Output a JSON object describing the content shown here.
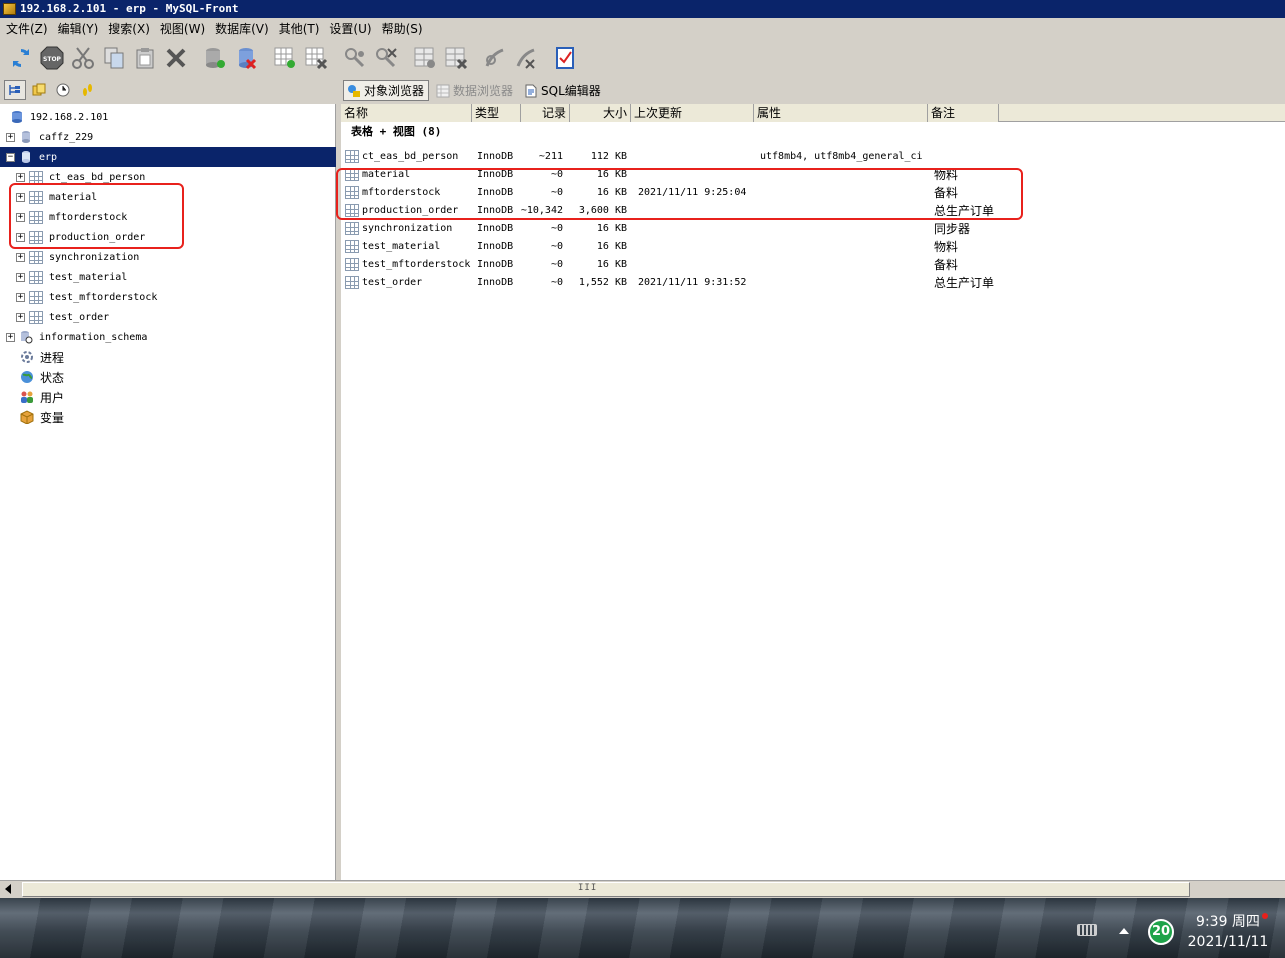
{
  "window": {
    "title": "192.168.2.101 - erp - MySQL-Front"
  },
  "menu": [
    "文件(Z)",
    "编辑(Y)",
    "搜索(X)",
    "视图(W)",
    "数据库(V)",
    "其他(T)",
    "设置(U)",
    "帮助(S)"
  ],
  "toolbar": {
    "icons": [
      "refresh-icon",
      "stop-icon",
      "cut-icon",
      "copy-icon",
      "paste-icon",
      "delete-icon",
      "new-database-icon",
      "drop-database-icon",
      "new-table-icon",
      "drop-table-icon",
      "new-field-icon",
      "drop-field-icon",
      "new-index-icon",
      "drop-index-icon",
      "new-foreign-key-icon",
      "drop-foreign-key-icon",
      "properties-icon"
    ],
    "stop_label": "STOP"
  },
  "views": {
    "object_browser": "对象浏览器",
    "data_browser": "数据浏览器",
    "sql_editor": "SQL编辑器"
  },
  "tree": {
    "server": "192.168.2.101",
    "databases": [
      {
        "name": "caffz_229",
        "expanded": false
      },
      {
        "name": "erp",
        "expanded": true,
        "selected": true,
        "tables": [
          "ct_eas_bd_person",
          "material",
          "mftorderstock",
          "production_order",
          "synchronization",
          "test_material",
          "test_mftorderstock",
          "test_order"
        ]
      },
      {
        "name": "information_schema",
        "expanded": false
      }
    ],
    "extras": [
      "进程",
      "状态",
      "用户",
      "变量"
    ]
  },
  "grid": {
    "columns": [
      "名称",
      "类型",
      "记录",
      "大小",
      "上次更新",
      "属性",
      "备注"
    ],
    "group_title": "表格 + 视图 (8)",
    "rows": [
      {
        "name": "ct_eas_bd_person",
        "type": "InnoDB",
        "records": "~211",
        "size": "112 KB",
        "updated": "",
        "attributes": "utf8mb4, utf8mb4_general_ci",
        "comment": ""
      },
      {
        "name": "material",
        "type": "InnoDB",
        "records": "~0",
        "size": "16 KB",
        "updated": "",
        "attributes": "",
        "comment": "物料"
      },
      {
        "name": "mftorderstock",
        "type": "InnoDB",
        "records": "~0",
        "size": "16 KB",
        "updated": "2021/11/11 9:25:04",
        "attributes": "",
        "comment": "备料"
      },
      {
        "name": "production_order",
        "type": "InnoDB",
        "records": "~10,342",
        "size": "3,600 KB",
        "updated": "",
        "attributes": "",
        "comment": "总生产订单"
      },
      {
        "name": "synchronization",
        "type": "InnoDB",
        "records": "~0",
        "size": "16 KB",
        "updated": "",
        "attributes": "",
        "comment": "同步器"
      },
      {
        "name": "test_material",
        "type": "InnoDB",
        "records": "~0",
        "size": "16 KB",
        "updated": "",
        "attributes": "",
        "comment": "物料"
      },
      {
        "name": "test_mftorderstock",
        "type": "InnoDB",
        "records": "~0",
        "size": "16 KB",
        "updated": "",
        "attributes": "",
        "comment": "备料"
      },
      {
        "name": "test_order",
        "type": "InnoDB",
        "records": "~0",
        "size": "1,552 KB",
        "updated": "2021/11/11 9:31:52",
        "attributes": "",
        "comment": "总生产订单"
      }
    ]
  },
  "scrollbar": {
    "grip": "III"
  },
  "taskbar": {
    "badge": "20",
    "time": "9:39 周四",
    "date": "2021/11/11"
  },
  "colors": {
    "highlight": "#e8211c",
    "selection": "#0a246a",
    "chrome": "#d4d0c8"
  }
}
